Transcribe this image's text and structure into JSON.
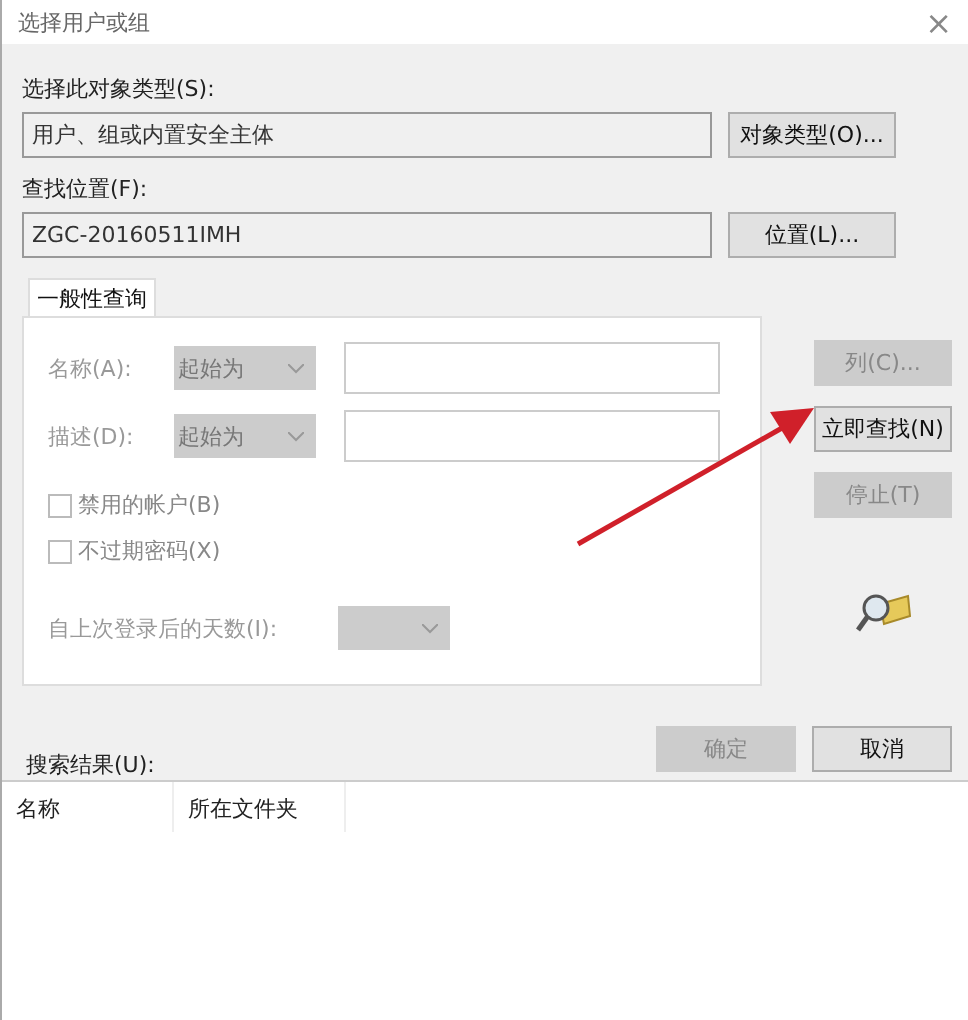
{
  "window": {
    "title": "选择用户或组",
    "close": "×"
  },
  "object_type": {
    "label": "选择此对象类型(S):",
    "value": "用户、组或内置安全主体",
    "button": "对象类型(O)..."
  },
  "location": {
    "label": "查找位置(F):",
    "value": "ZGC-20160511IMH",
    "button": "位置(L)..."
  },
  "tabs": [
    {
      "label": "一般性查询",
      "selected": true
    }
  ],
  "query": {
    "rows": [
      {
        "label": "名称(A):",
        "mode": "起始为"
      },
      {
        "label": "描述(D):",
        "mode": "起始为"
      }
    ],
    "checkboxes": [
      {
        "label": "禁用的帐户(B)",
        "checked": false,
        "disabled": true
      },
      {
        "label": "不过期密码(X)",
        "checked": false,
        "disabled": true
      }
    ],
    "days_label": "自上次登录后的天数(I):"
  },
  "side_buttons": [
    {
      "label": "列(C)...",
      "disabled": true
    },
    {
      "label": "立即查找(N)",
      "disabled": false
    },
    {
      "label": "停止(T)",
      "disabled": true
    }
  ],
  "results_label": "搜索结果(U):",
  "dialog_buttons": [
    {
      "label": "确定",
      "disabled": true
    },
    {
      "label": "取消",
      "disabled": false
    }
  ],
  "results": {
    "columns": [
      "名称",
      "所在文件夹"
    ]
  }
}
